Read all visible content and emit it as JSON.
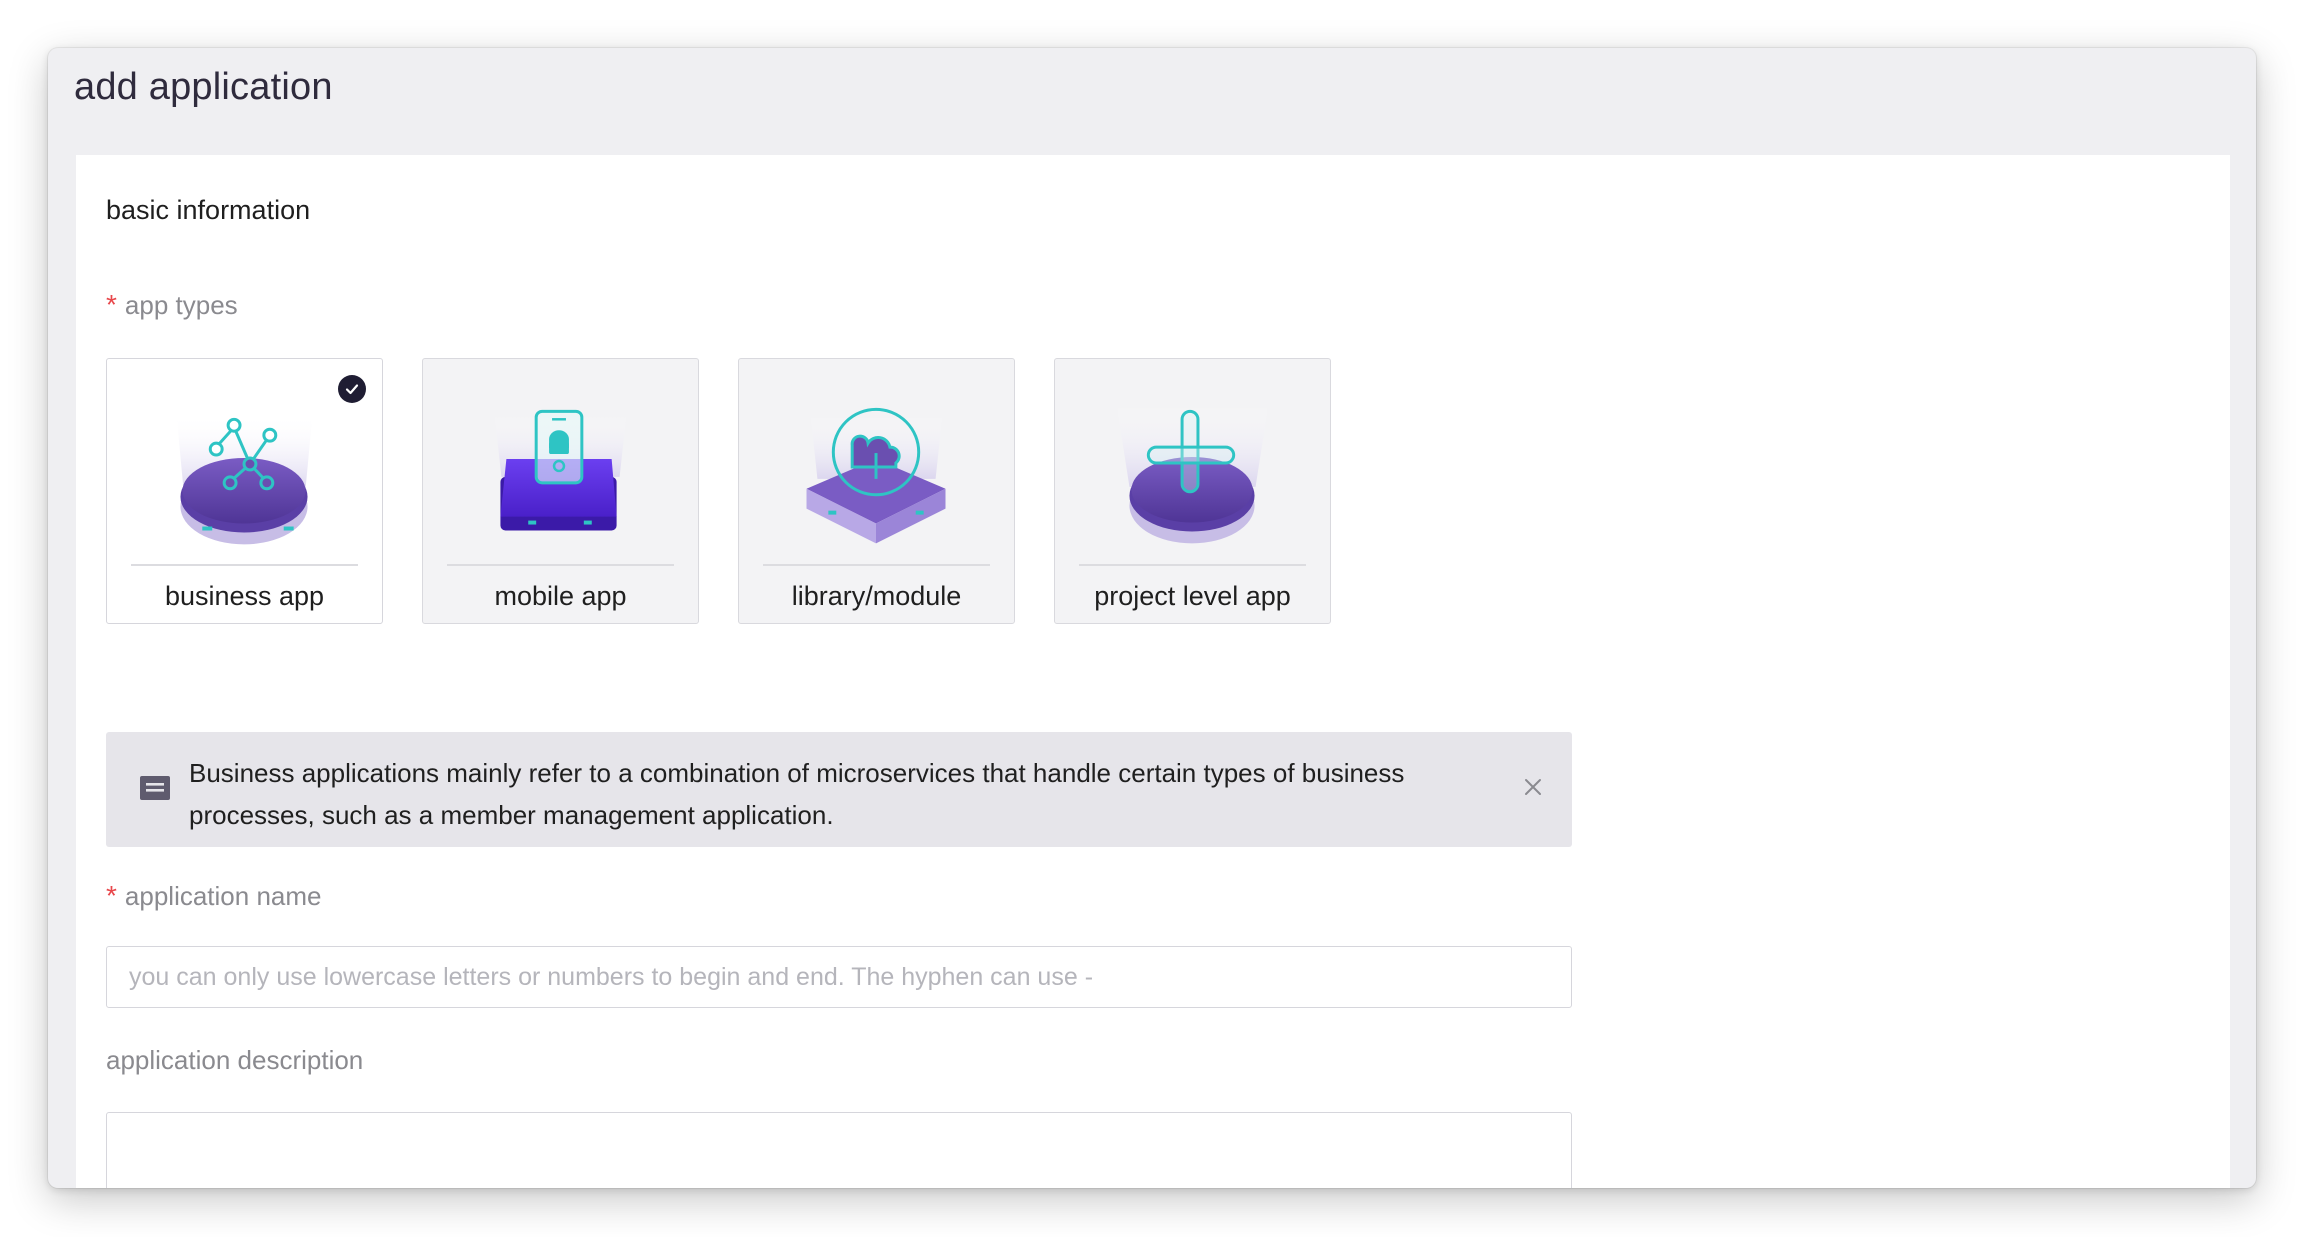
{
  "page": {
    "title": "add application"
  },
  "form": {
    "section_title": "basic information",
    "app_types_label": "app types",
    "required_mark": "*",
    "app_types": [
      {
        "label": "business app",
        "icon": "business-app-illustration-icon",
        "selected": true
      },
      {
        "label": "mobile app",
        "icon": "mobile-app-illustration-icon",
        "selected": false
      },
      {
        "label": "library/module",
        "icon": "library-module-illustration-icon",
        "selected": false
      },
      {
        "label": "project level app",
        "icon": "project-level-app-illustration-icon",
        "selected": false
      }
    ],
    "info_text": "Business applications mainly refer to a combination of microservices that handle certain types of business processes, such as a member management application.",
    "app_name_label": "application name",
    "app_name_placeholder": "you can only use lowercase letters or numbers to begin and end. The hyphen can use -",
    "app_name_value": "",
    "app_desc_label": "application description",
    "app_desc_value": ""
  },
  "colors": {
    "accent_dark": "#1f1d33",
    "required": "#e8474b",
    "platform_purple": "#6a4fb0",
    "icon_teal": "#2ec4c4"
  }
}
